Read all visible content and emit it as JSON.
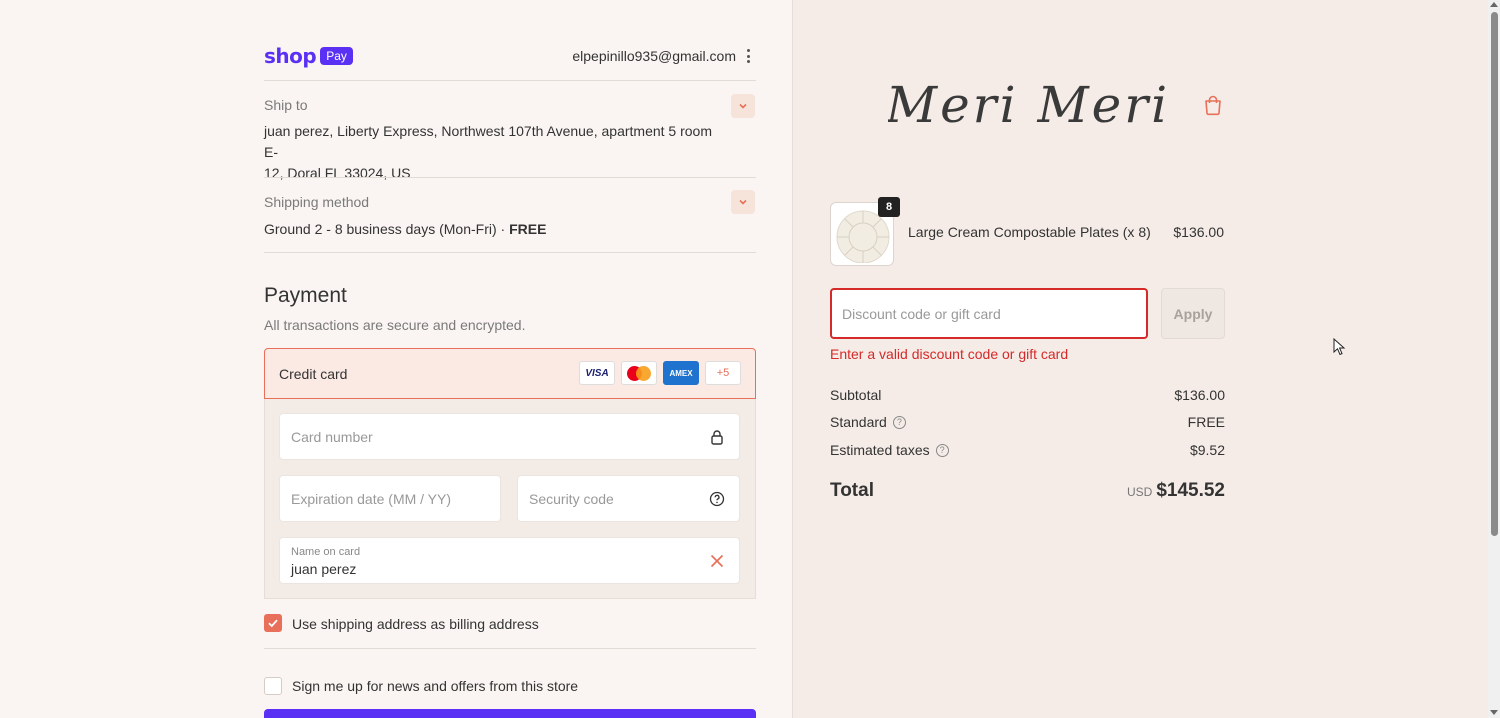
{
  "shop_pay": {
    "brand": "shop",
    "badge": "Pay",
    "email": "elpepinillo935@gmail.com"
  },
  "ship_to": {
    "label": "Ship to",
    "address_line1": "juan perez, Liberty Express, Northwest 107th Avenue, apartment 5 room E-",
    "address_line2": "12, Doral FL 33024, US"
  },
  "shipping_method": {
    "label": "Shipping method",
    "value": "Ground 2 - 8 business days (Mon-Fri) · ",
    "price": "FREE"
  },
  "payment": {
    "title": "Payment",
    "subtitle": "All transactions are secure and encrypted.",
    "method_label": "Credit card",
    "card_logos": [
      "VISA",
      "mastercard",
      "AMEX",
      "+5"
    ],
    "card_number_placeholder": "Card number",
    "expiration_placeholder": "Expiration date (MM / YY)",
    "security_placeholder": "Security code",
    "name_label": "Name on card",
    "name_value": "juan perez"
  },
  "options": {
    "billing_same": "Use shipping address as billing address",
    "billing_same_checked": true,
    "newsletter": "Sign me up for news and offers from this store",
    "newsletter_checked": false
  },
  "store": {
    "name": "Meri Meri"
  },
  "cart": {
    "item_name": "Large Cream Compostable Plates (x 8)",
    "item_qty": "8",
    "item_price": "$136.00"
  },
  "discount": {
    "placeholder": "Discount code or gift card",
    "apply_label": "Apply",
    "error": "Enter a valid discount code or gift card"
  },
  "summary": {
    "subtotal_label": "Subtotal",
    "subtotal_value": "$136.00",
    "shipping_label": "Standard",
    "shipping_value": "FREE",
    "taxes_label": "Estimated taxes",
    "taxes_value": "$9.52",
    "total_label": "Total",
    "total_currency": "USD",
    "total_value": "$145.52"
  },
  "colors": {
    "accent": "#e8705a",
    "shop_pay": "#5a31f4",
    "error": "#d42a2a"
  }
}
